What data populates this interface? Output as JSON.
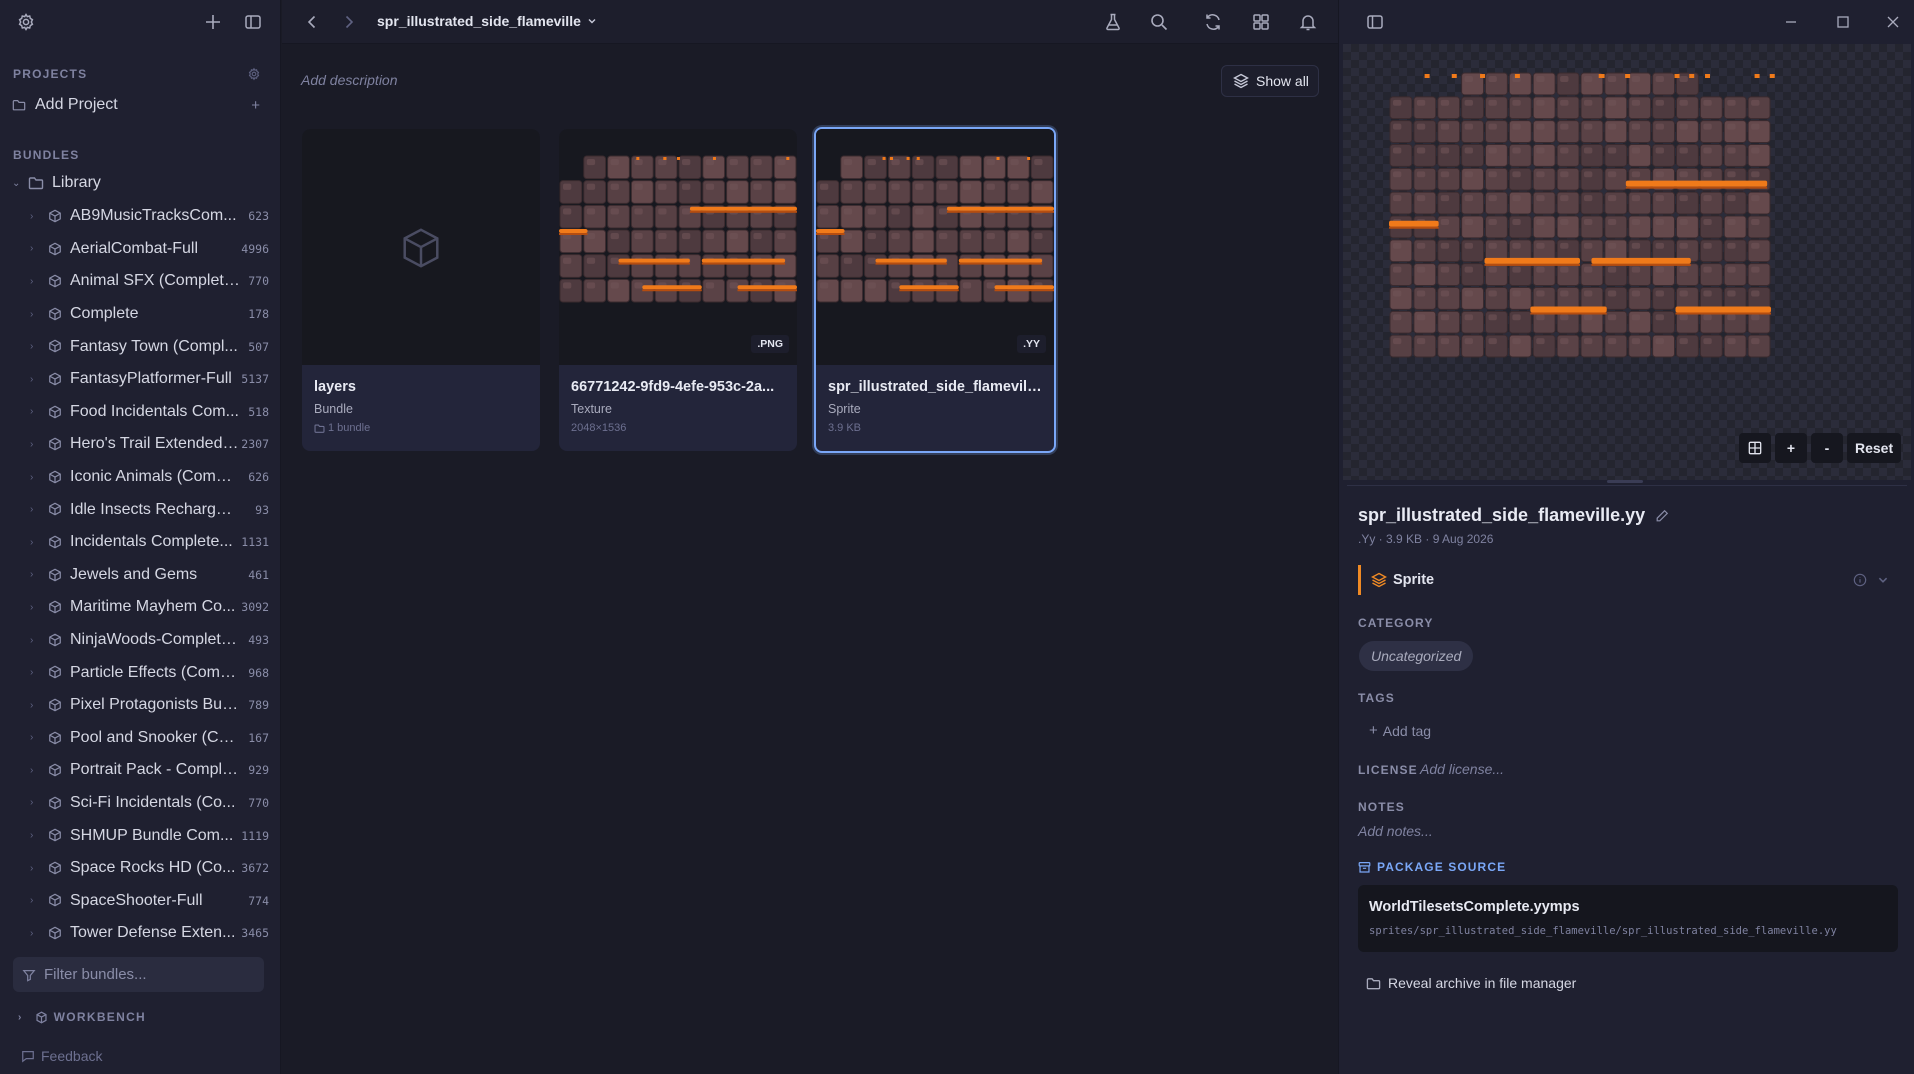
{
  "sidebar": {
    "projects_title": "PROJECTS",
    "add_project": "Add Project",
    "bundles_title": "BUNDLES",
    "library": "Library",
    "bundles": [
      {
        "name": "AB9MusicTracksCom...",
        "count": "623"
      },
      {
        "name": "AerialCombat-Full",
        "count": "4996"
      },
      {
        "name": "Animal SFX (Complete...",
        "count": "770"
      },
      {
        "name": "Complete",
        "count": "178"
      },
      {
        "name": "Fantasy Town (Compl...",
        "count": "507"
      },
      {
        "name": "FantasyPlatformer-Full",
        "count": "5137"
      },
      {
        "name": "Food Incidentals Com...",
        "count": "518"
      },
      {
        "name": "Hero's Trail Extended ...",
        "count": "2307"
      },
      {
        "name": "Iconic Animals (Compl...",
        "count": "626"
      },
      {
        "name": "Idle Insects Recharged ...",
        "count": "93"
      },
      {
        "name": "Incidentals Complete...",
        "count": "1131"
      },
      {
        "name": "Jewels and Gems",
        "count": "461"
      },
      {
        "name": "Maritime Mayhem Co...",
        "count": "3092"
      },
      {
        "name": "NinjaWoods-Complete...",
        "count": "493"
      },
      {
        "name": "Particle Effects (Comp...",
        "count": "968"
      },
      {
        "name": "Pixel Protagonists Bun...",
        "count": "789"
      },
      {
        "name": "Pool and Snooker (Co...",
        "count": "167"
      },
      {
        "name": "Portrait Pack - Comple...",
        "count": "929"
      },
      {
        "name": "Sci-Fi Incidentals (Co...",
        "count": "770"
      },
      {
        "name": "SHMUP Bundle Com...",
        "count": "1119"
      },
      {
        "name": "Space Rocks HD (Co...",
        "count": "3672"
      },
      {
        "name": "SpaceShooter-Full",
        "count": "774"
      },
      {
        "name": "Tower Defense Exten...",
        "count": "3465"
      }
    ],
    "filter_placeholder": "Filter bundles...",
    "workbench": "WORKBENCH",
    "feedback": "Feedback"
  },
  "main": {
    "breadcrumb": "spr_illustrated_side_flameville",
    "description_placeholder": "Add description",
    "show_all": "Show all",
    "cards": [
      {
        "title": "layers",
        "kind": "Bundle",
        "meta": "1 bundle",
        "badge": ""
      },
      {
        "title": "66771242-9fd9-4efe-953c-2a...",
        "kind": "Texture",
        "meta": "2048×1536",
        "badge": ".PNG"
      },
      {
        "title": "spr_illustrated_side_flameville...",
        "kind": "Sprite",
        "meta": "3.9 KB",
        "badge": ".YY"
      }
    ]
  },
  "panel": {
    "zoom": {
      "plus": "+",
      "minus": "-",
      "reset": "Reset"
    },
    "file_title": "spr_illustrated_side_flameville.yy",
    "file_meta": ".Yy · 3.9 KB · 9 Aug 2026",
    "type": "Sprite",
    "category_label": "CATEGORY",
    "category_value": "Uncategorized",
    "tags_label": "TAGS",
    "add_tag": "Add tag",
    "license_label": "LICENSE",
    "license_placeholder": "Add license...",
    "notes_label": "NOTES",
    "notes_placeholder": "Add notes...",
    "package_label": "PACKAGE SOURCE",
    "package_name": "WorldTilesetsComplete.yymps",
    "package_path": "sprites/spr_illustrated_side_flameville/spr_illustrated_side_flameville.yy",
    "reveal": "Reveal archive in file manager"
  },
  "colors": {
    "accent": "#7aa7f7",
    "sprite_accent": "#f08a24",
    "lava": "#f07a1a"
  }
}
